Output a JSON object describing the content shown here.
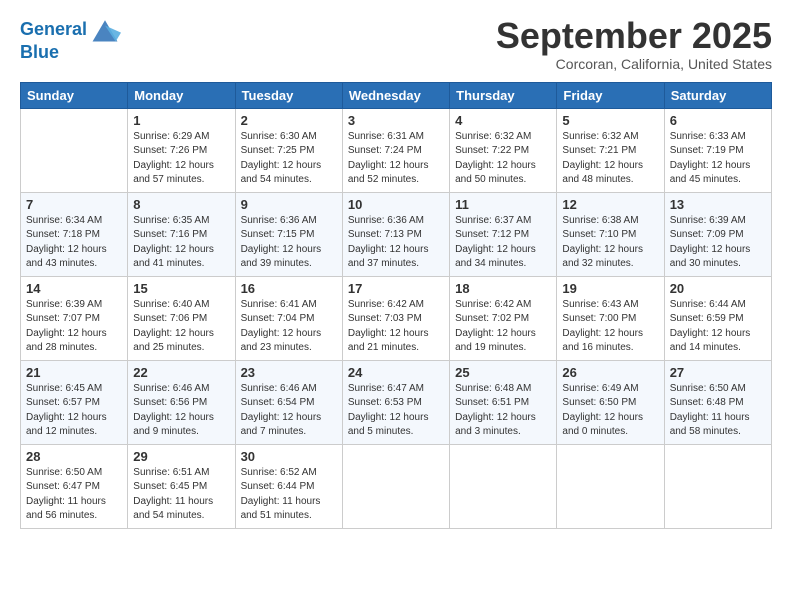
{
  "header": {
    "logo_line1": "General",
    "logo_line2": "Blue",
    "month": "September 2025",
    "location": "Corcoran, California, United States"
  },
  "weekdays": [
    "Sunday",
    "Monday",
    "Tuesday",
    "Wednesday",
    "Thursday",
    "Friday",
    "Saturday"
  ],
  "weeks": [
    [
      {
        "day": "",
        "info": ""
      },
      {
        "day": "1",
        "info": "Sunrise: 6:29 AM\nSunset: 7:26 PM\nDaylight: 12 hours\nand 57 minutes."
      },
      {
        "day": "2",
        "info": "Sunrise: 6:30 AM\nSunset: 7:25 PM\nDaylight: 12 hours\nand 54 minutes."
      },
      {
        "day": "3",
        "info": "Sunrise: 6:31 AM\nSunset: 7:24 PM\nDaylight: 12 hours\nand 52 minutes."
      },
      {
        "day": "4",
        "info": "Sunrise: 6:32 AM\nSunset: 7:22 PM\nDaylight: 12 hours\nand 50 minutes."
      },
      {
        "day": "5",
        "info": "Sunrise: 6:32 AM\nSunset: 7:21 PM\nDaylight: 12 hours\nand 48 minutes."
      },
      {
        "day": "6",
        "info": "Sunrise: 6:33 AM\nSunset: 7:19 PM\nDaylight: 12 hours\nand 45 minutes."
      }
    ],
    [
      {
        "day": "7",
        "info": "Sunrise: 6:34 AM\nSunset: 7:18 PM\nDaylight: 12 hours\nand 43 minutes."
      },
      {
        "day": "8",
        "info": "Sunrise: 6:35 AM\nSunset: 7:16 PM\nDaylight: 12 hours\nand 41 minutes."
      },
      {
        "day": "9",
        "info": "Sunrise: 6:36 AM\nSunset: 7:15 PM\nDaylight: 12 hours\nand 39 minutes."
      },
      {
        "day": "10",
        "info": "Sunrise: 6:36 AM\nSunset: 7:13 PM\nDaylight: 12 hours\nand 37 minutes."
      },
      {
        "day": "11",
        "info": "Sunrise: 6:37 AM\nSunset: 7:12 PM\nDaylight: 12 hours\nand 34 minutes."
      },
      {
        "day": "12",
        "info": "Sunrise: 6:38 AM\nSunset: 7:10 PM\nDaylight: 12 hours\nand 32 minutes."
      },
      {
        "day": "13",
        "info": "Sunrise: 6:39 AM\nSunset: 7:09 PM\nDaylight: 12 hours\nand 30 minutes."
      }
    ],
    [
      {
        "day": "14",
        "info": "Sunrise: 6:39 AM\nSunset: 7:07 PM\nDaylight: 12 hours\nand 28 minutes."
      },
      {
        "day": "15",
        "info": "Sunrise: 6:40 AM\nSunset: 7:06 PM\nDaylight: 12 hours\nand 25 minutes."
      },
      {
        "day": "16",
        "info": "Sunrise: 6:41 AM\nSunset: 7:04 PM\nDaylight: 12 hours\nand 23 minutes."
      },
      {
        "day": "17",
        "info": "Sunrise: 6:42 AM\nSunset: 7:03 PM\nDaylight: 12 hours\nand 21 minutes."
      },
      {
        "day": "18",
        "info": "Sunrise: 6:42 AM\nSunset: 7:02 PM\nDaylight: 12 hours\nand 19 minutes."
      },
      {
        "day": "19",
        "info": "Sunrise: 6:43 AM\nSunset: 7:00 PM\nDaylight: 12 hours\nand 16 minutes."
      },
      {
        "day": "20",
        "info": "Sunrise: 6:44 AM\nSunset: 6:59 PM\nDaylight: 12 hours\nand 14 minutes."
      }
    ],
    [
      {
        "day": "21",
        "info": "Sunrise: 6:45 AM\nSunset: 6:57 PM\nDaylight: 12 hours\nand 12 minutes."
      },
      {
        "day": "22",
        "info": "Sunrise: 6:46 AM\nSunset: 6:56 PM\nDaylight: 12 hours\nand 9 minutes."
      },
      {
        "day": "23",
        "info": "Sunrise: 6:46 AM\nSunset: 6:54 PM\nDaylight: 12 hours\nand 7 minutes."
      },
      {
        "day": "24",
        "info": "Sunrise: 6:47 AM\nSunset: 6:53 PM\nDaylight: 12 hours\nand 5 minutes."
      },
      {
        "day": "25",
        "info": "Sunrise: 6:48 AM\nSunset: 6:51 PM\nDaylight: 12 hours\nand 3 minutes."
      },
      {
        "day": "26",
        "info": "Sunrise: 6:49 AM\nSunset: 6:50 PM\nDaylight: 12 hours\nand 0 minutes."
      },
      {
        "day": "27",
        "info": "Sunrise: 6:50 AM\nSunset: 6:48 PM\nDaylight: 11 hours\nand 58 minutes."
      }
    ],
    [
      {
        "day": "28",
        "info": "Sunrise: 6:50 AM\nSunset: 6:47 PM\nDaylight: 11 hours\nand 56 minutes."
      },
      {
        "day": "29",
        "info": "Sunrise: 6:51 AM\nSunset: 6:45 PM\nDaylight: 11 hours\nand 54 minutes."
      },
      {
        "day": "30",
        "info": "Sunrise: 6:52 AM\nSunset: 6:44 PM\nDaylight: 11 hours\nand 51 minutes."
      },
      {
        "day": "",
        "info": ""
      },
      {
        "day": "",
        "info": ""
      },
      {
        "day": "",
        "info": ""
      },
      {
        "day": "",
        "info": ""
      }
    ]
  ]
}
